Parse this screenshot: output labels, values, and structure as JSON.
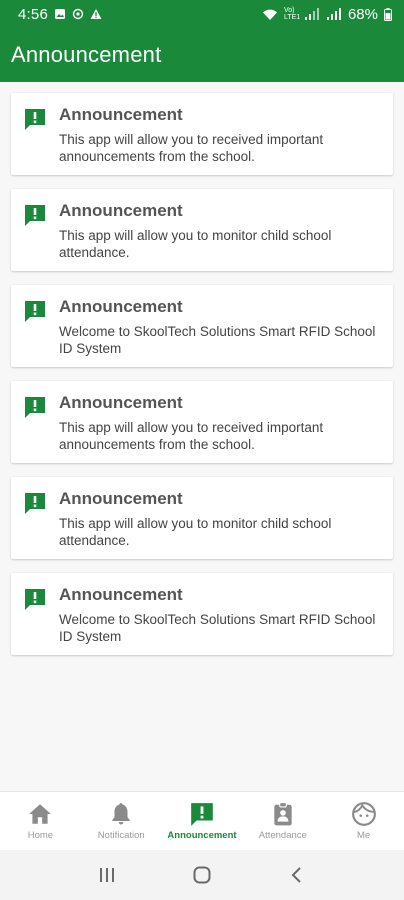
{
  "status_bar": {
    "time": "4:56",
    "battery": "68%",
    "network": "Vo) LTE1"
  },
  "app_bar": {
    "title": "Announcement"
  },
  "announcements": [
    {
      "title": "Announcement",
      "body": "This app will allow you to received important announcements from the school."
    },
    {
      "title": "Announcement",
      "body": "This app will allow you to monitor child school attendance."
    },
    {
      "title": "Announcement",
      "body": "Welcome to SkoolTech Solutions Smart RFID School ID System"
    },
    {
      "title": "Announcement",
      "body": "This app will allow you to received important announcements from the school."
    },
    {
      "title": "Announcement",
      "body": "This app will allow you to monitor child school attendance."
    },
    {
      "title": "Announcement",
      "body": "Welcome to SkoolTech Solutions Smart RFID School ID System"
    }
  ],
  "bottom_nav": {
    "items": [
      {
        "label": "Home",
        "icon": "home-icon",
        "active": false
      },
      {
        "label": "Notification",
        "icon": "bell-icon",
        "active": false
      },
      {
        "label": "Announcement",
        "icon": "announcement-icon",
        "active": true
      },
      {
        "label": "Attendance",
        "icon": "attendance-icon",
        "active": false
      },
      {
        "label": "Me",
        "icon": "face-icon",
        "active": false
      }
    ]
  },
  "colors": {
    "primary": "#1a8a3a",
    "inactive": "#9a9a9a",
    "background": "#f7f7f7"
  }
}
